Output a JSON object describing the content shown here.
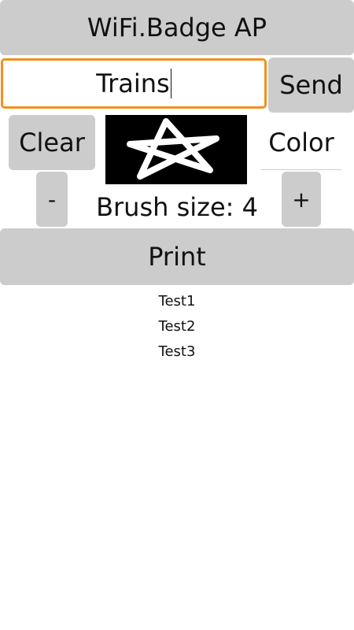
{
  "app": {
    "title_button": "WiFi.Badge AP"
  },
  "message": {
    "value": "Trains",
    "send_label": "Send"
  },
  "drawing": {
    "clear_label": "Clear",
    "color_label": "Color",
    "minus_label": "-",
    "plus_label": "+",
    "brush_size_text": "Brush size: 4",
    "canvas_background": "#000000",
    "stroke_color": "#ffffff"
  },
  "print_label": "Print",
  "list_items": [
    "Test1",
    "Test2",
    "Test3"
  ],
  "colors": {
    "button_bg": "#cccccc",
    "input_focus_border": "#f4901e",
    "text": "#111111",
    "background": "#ffffff"
  }
}
